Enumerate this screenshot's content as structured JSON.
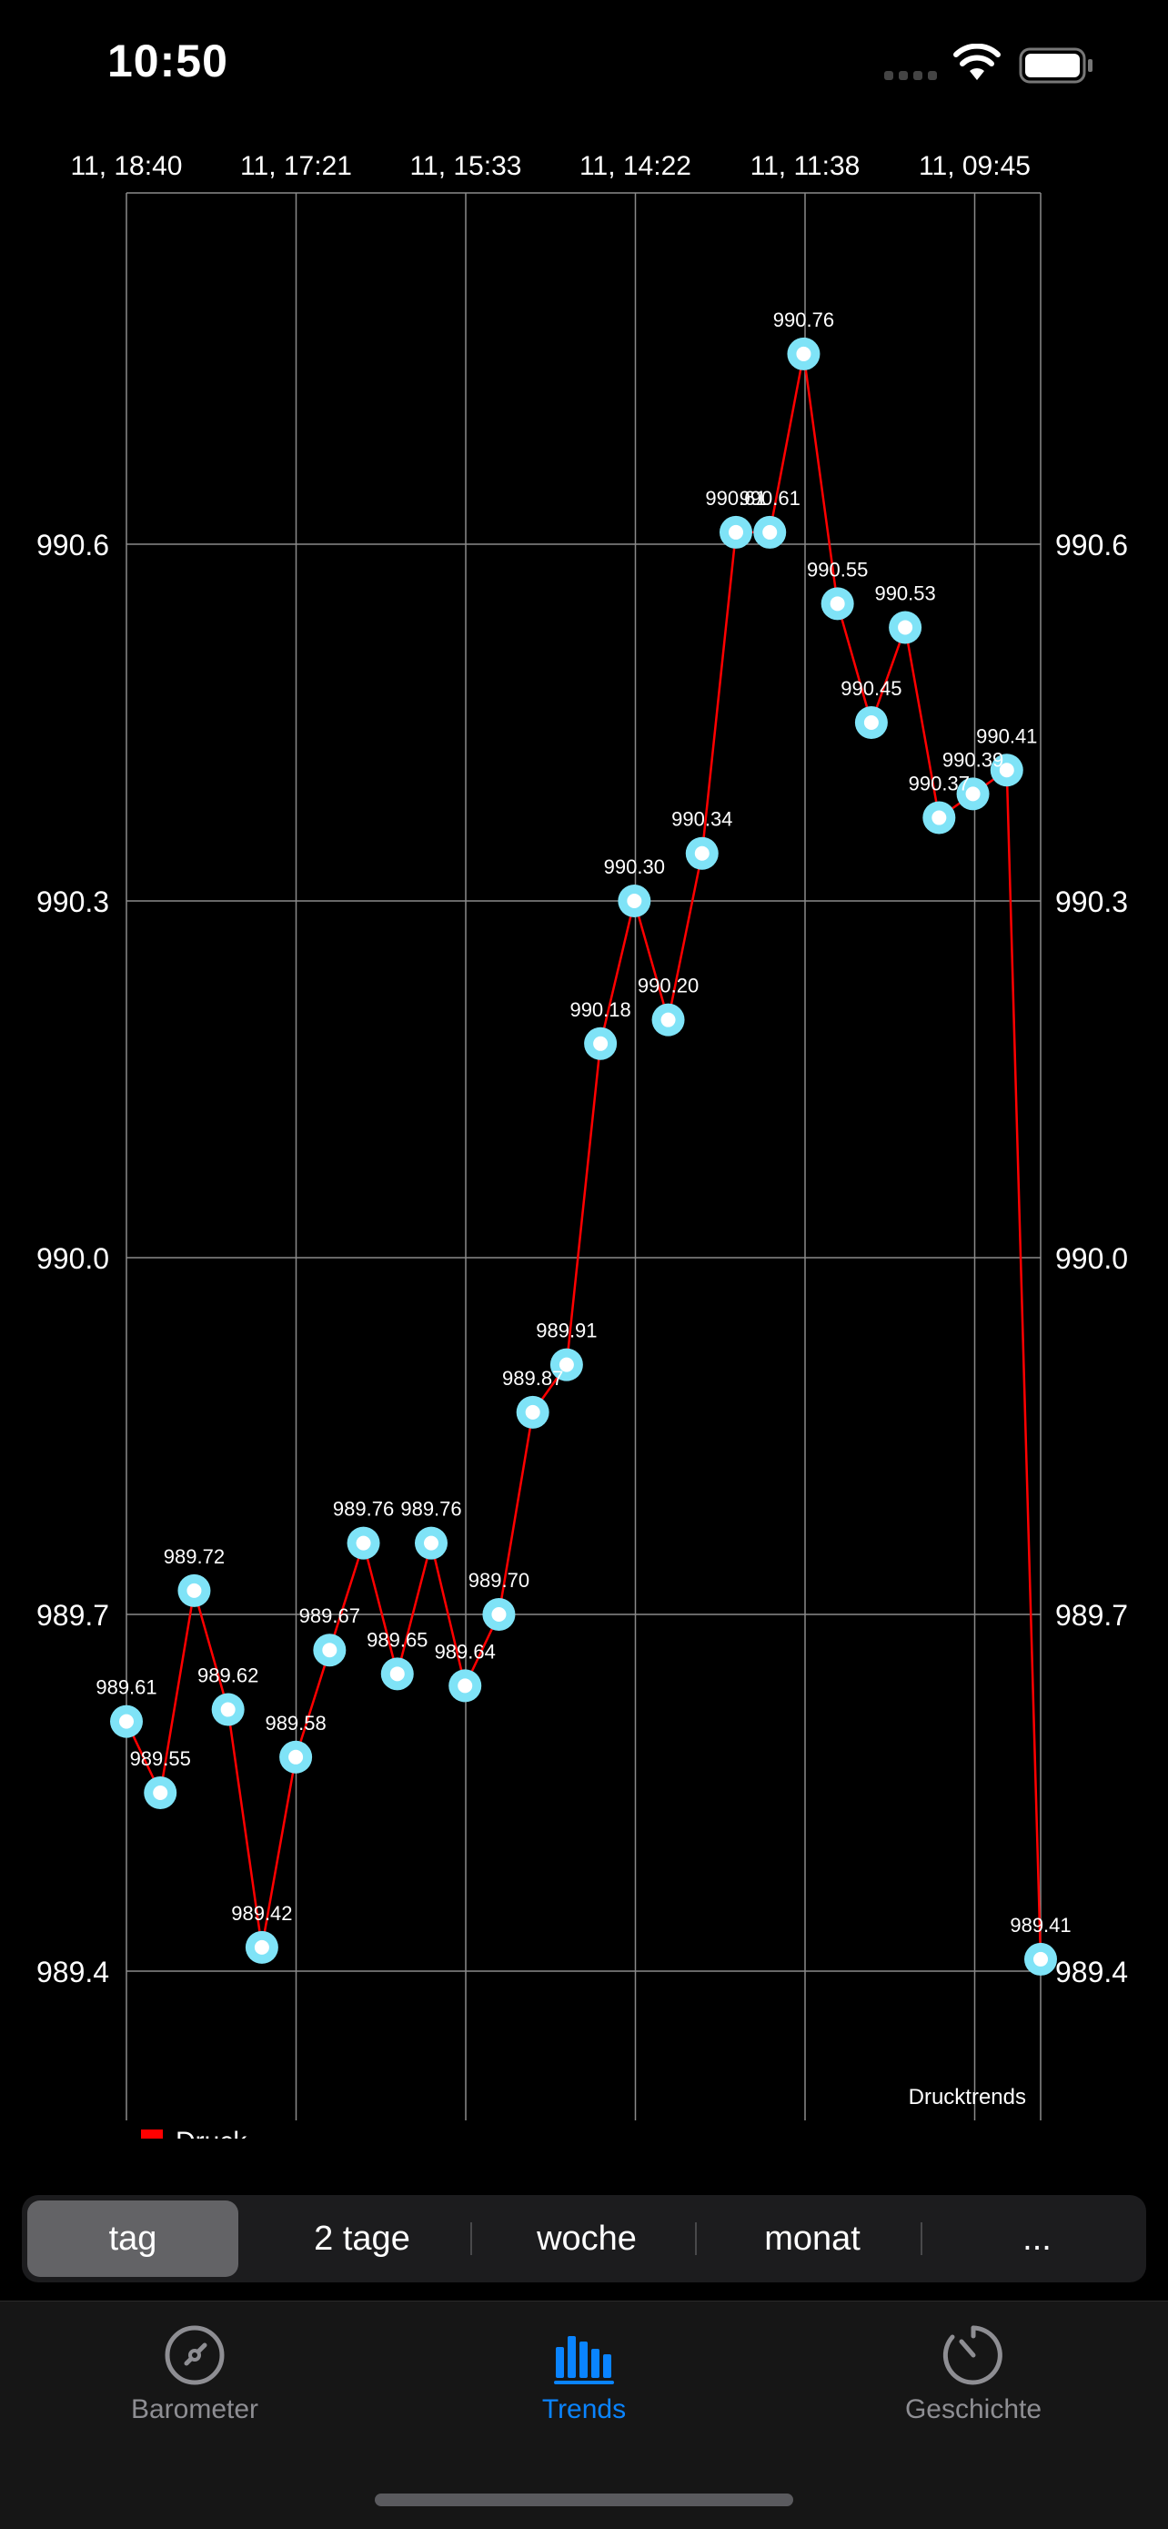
{
  "status_bar": {
    "time": "10:50"
  },
  "chart_data": {
    "type": "line",
    "x": [
      "11, 18:40",
      "11, 17:21",
      "11, 15:33",
      "11, 14:22",
      "11, 11:38",
      "11, 09:45"
    ],
    "series": [
      {
        "name": "Druck",
        "color": "#ff0000",
        "values": [
          989.61,
          989.55,
          989.72,
          989.62,
          989.42,
          989.58,
          989.67,
          989.76,
          989.65,
          989.76,
          989.64,
          989.7,
          989.87,
          989.91,
          990.18,
          990.3,
          990.2,
          990.34,
          990.61,
          990.61,
          990.76,
          990.55,
          990.45,
          990.53,
          990.37,
          990.39,
          990.41,
          989.41
        ],
        "labels": [
          "989.61",
          "989.55",
          "989.72",
          "989.62",
          "989.42",
          "989.58",
          "989.67",
          "989.76",
          "989.65",
          "989.76",
          "989.64",
          "989.70",
          "989.87",
          "989.91",
          "990.18",
          "990.30",
          "990.20",
          "990.34",
          "990.61",
          "990.61",
          "990.76",
          "990.55",
          "990.45",
          "990.53",
          "990.37",
          "990.39",
          "990.41",
          "989.41"
        ]
      }
    ],
    "y_ticks": [
      "990.6",
      "990.3",
      "990.0",
      "989.7",
      "989.4"
    ],
    "ylim": [
      989.4,
      990.6
    ],
    "grid": true,
    "legend": "bottom-left",
    "description": "Drucktrends"
  },
  "segmented_control": {
    "options": [
      "tag",
      "2 tage",
      "woche",
      "monat",
      "..."
    ],
    "selected": "tag"
  },
  "tab_bar": {
    "items": [
      {
        "label": "Barometer",
        "icon": "barometer-icon"
      },
      {
        "label": "Trends",
        "icon": "trends-icon"
      },
      {
        "label": "Geschichte",
        "icon": "history-icon"
      }
    ],
    "selected": "Trends",
    "accent": "#0a84ff"
  }
}
